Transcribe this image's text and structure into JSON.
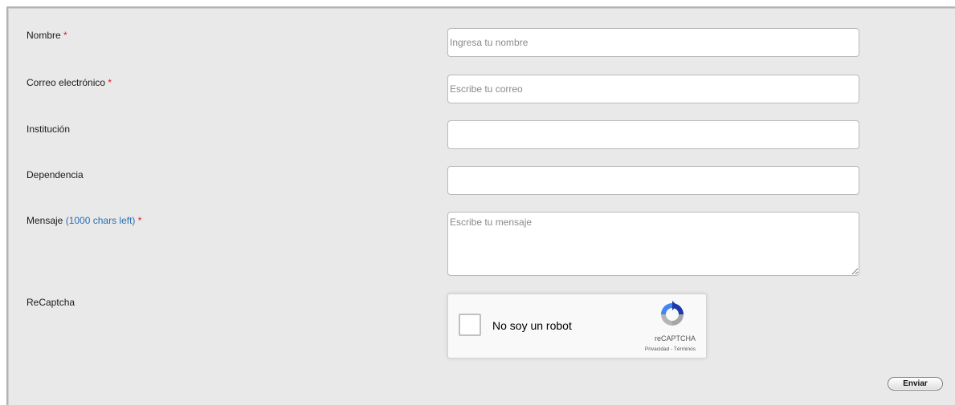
{
  "form": {
    "name": {
      "label": "Nombre",
      "required": "*",
      "placeholder": "Ingresa tu nombre",
      "value": ""
    },
    "email": {
      "label": "Correo electrónico",
      "required": "*",
      "placeholder": "Escribe tu correo",
      "value": ""
    },
    "institution": {
      "label": "Institución",
      "placeholder": "",
      "value": ""
    },
    "department": {
      "label": "Dependencia",
      "placeholder": "",
      "value": ""
    },
    "message": {
      "label": "Mensaje",
      "chars_left": "(1000 chars left)",
      "required": "*",
      "placeholder": "Escribe tu mensaje",
      "value": ""
    },
    "recaptcha": {
      "label": "ReCaptcha",
      "checkbox_text": "No soy un robot",
      "brand": "reCAPTCHA",
      "links": "Privacidad - Términos",
      "logo_icon": "recaptcha-logo-icon"
    },
    "submit_label": "Enviar"
  },
  "colors": {
    "background": "#e9e9e9",
    "required": "#e0182e",
    "chars_left": "#2a6db5"
  }
}
